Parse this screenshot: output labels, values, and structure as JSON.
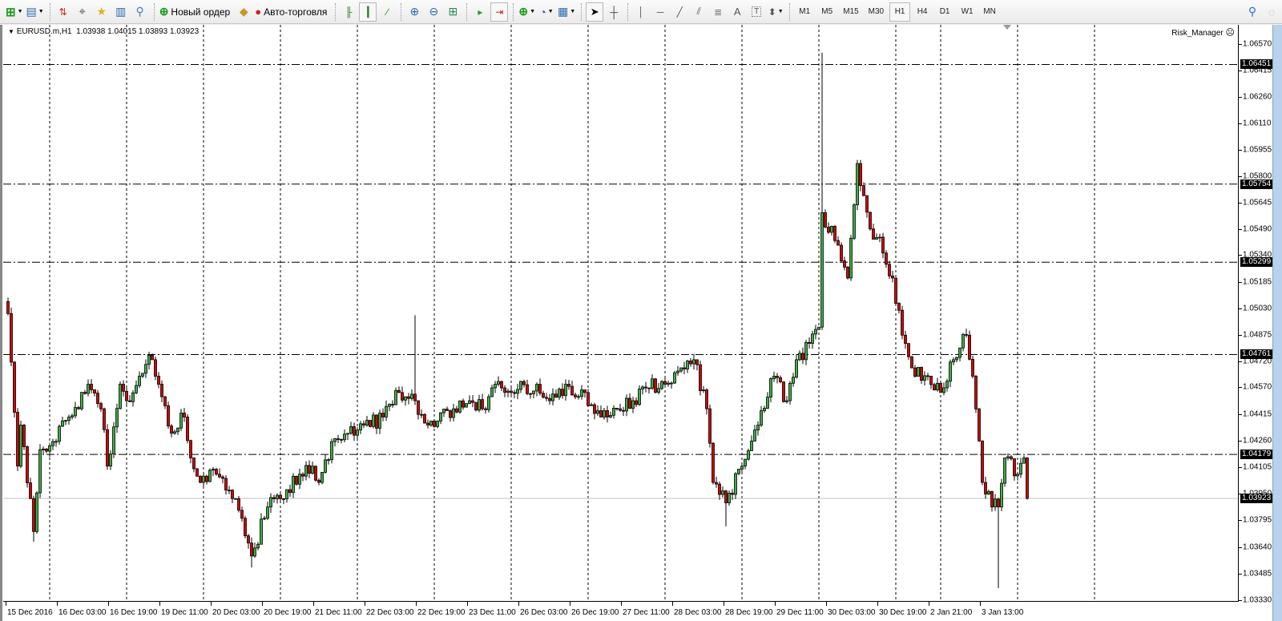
{
  "toolbar": {
    "new_order_label": "Новый ордер",
    "autotrading_label": "Авто-торговля",
    "text_tool_label": "A",
    "text_label_tool": "T",
    "periods": [
      "M1",
      "M5",
      "M15",
      "M30",
      "H1",
      "H4",
      "D1",
      "W1",
      "MN"
    ],
    "active_period": "H1"
  },
  "chart_header": {
    "symbol": "EURUSD.m,H1",
    "open": "1.03938",
    "high": "1.04015",
    "low": "1.03893",
    "close": "1.03923"
  },
  "expert": {
    "name": "Risk_Manager",
    "status_icon": "frown-icon"
  },
  "colors": {
    "bull": "#3cb043",
    "bear": "#d40000",
    "grid": "#000000",
    "current_line": "#c0c0c0"
  },
  "chart_data": {
    "type": "candlestick",
    "title": "EURUSD.m,H1",
    "bar_count": 319,
    "ylim": [
      1.0333,
      1.0657
    ],
    "price_ticks": [
      "1.06570",
      "1.06415",
      "1.06260",
      "1.06110",
      "1.05955",
      "1.05800",
      "1.05645",
      "1.05490",
      "1.05340",
      "1.05185",
      "1.05030",
      "1.04875",
      "1.04720",
      "1.04570",
      "1.04415",
      "1.04260",
      "1.04105",
      "1.03950",
      "1.03795",
      "1.03640",
      "1.03485",
      "1.03330"
    ],
    "time_labels": [
      "15 Dec 2016",
      "16 Dec 03:00",
      "16 Dec 19:00",
      "19 Dec 11:00",
      "20 Dec 03:00",
      "20 Dec 19:00",
      "21 Dec 11:00",
      "22 Dec 03:00",
      "22 Dec 19:00",
      "23 Dec 11:00",
      "26 Dec 03:00",
      "26 Dec 19:00",
      "27 Dec 11:00",
      "28 Dec 03:00",
      "28 Dec 19:00",
      "29 Dec 11:00",
      "30 Dec 03:00",
      "30 Dec 19:00",
      "2 Jan 21:00",
      "3 Jan 13:00"
    ],
    "bars_per_time_label": 16,
    "horizontal_lines": [
      "1.06451",
      "1.05754",
      "1.05299",
      "1.04761",
      "1.04179"
    ],
    "current_price": "1.03923",
    "close_path": [
      [
        0,
        1.05
      ],
      [
        3,
        1.04111
      ],
      [
        4,
        1.0435
      ],
      [
        8,
        1.0373
      ],
      [
        10,
        1.04207
      ],
      [
        14,
        1.04254
      ],
      [
        19,
        1.04397
      ],
      [
        25,
        1.04588
      ],
      [
        29,
        1.04445
      ],
      [
        31,
        1.04111
      ],
      [
        35,
        1.04588
      ],
      [
        37,
        1.04492
      ],
      [
        41,
        1.04635
      ],
      [
        45,
        1.04731
      ],
      [
        47,
        1.04588
      ],
      [
        51,
        1.04302
      ],
      [
        55,
        1.04397
      ],
      [
        57,
        1.04159
      ],
      [
        60,
        1.04016
      ],
      [
        65,
        1.04064
      ],
      [
        71,
        1.03921
      ],
      [
        76,
        1.03587
      ],
      [
        81,
        1.03873
      ],
      [
        86,
        1.03921
      ],
      [
        91,
        1.04064
      ],
      [
        95,
        1.04111
      ],
      [
        97,
        1.04016
      ],
      [
        101,
        1.04254
      ],
      [
        106,
        1.04302
      ],
      [
        111,
        1.0435
      ],
      [
        117,
        1.04397
      ],
      [
        122,
        1.0454
      ],
      [
        127,
        1.04492
      ],
      [
        131,
        1.0435
      ],
      [
        134,
        1.04373
      ],
      [
        139,
        1.04445
      ],
      [
        144,
        1.04492
      ],
      [
        148,
        1.04445
      ],
      [
        152,
        1.04588
      ],
      [
        157,
        1.0454
      ],
      [
        165,
        1.04588
      ],
      [
        169,
        1.04492
      ],
      [
        174,
        1.04588
      ],
      [
        180,
        1.0454
      ],
      [
        185,
        1.04397
      ],
      [
        190,
        1.04445
      ],
      [
        195,
        1.04492
      ],
      [
        200,
        1.04565
      ],
      [
        205,
        1.04588
      ],
      [
        213,
        1.04707
      ],
      [
        214,
        1.04731
      ],
      [
        218,
        1.04445
      ],
      [
        220,
        1.04016
      ],
      [
        224,
        1.03897
      ],
      [
        229,
        1.04111
      ],
      [
        234,
        1.0435
      ],
      [
        239,
        1.04635
      ],
      [
        243,
        1.04492
      ],
      [
        246,
        1.04731
      ],
      [
        250,
        1.04826
      ],
      [
        253,
        1.04921
      ],
      [
        254,
        1.05588
      ],
      [
        259,
        1.05398
      ],
      [
        262,
        1.05207
      ],
      [
        265,
        1.05874
      ],
      [
        269,
        1.05493
      ],
      [
        272,
        1.05445
      ],
      [
        276,
        1.05207
      ],
      [
        279,
        1.04874
      ],
      [
        282,
        1.04683
      ],
      [
        287,
        1.04635
      ],
      [
        291,
        1.0454
      ],
      [
        295,
        1.04731
      ],
      [
        299,
        1.04874
      ],
      [
        301,
        1.04635
      ],
      [
        304,
        1.04016
      ],
      [
        307,
        1.03873
      ],
      [
        309,
        1.03873
      ],
      [
        311,
        1.04159
      ],
      [
        315,
        1.04064
      ],
      [
        317,
        1.04159
      ],
      [
        318,
        1.03923
      ]
    ],
    "extremes": [
      {
        "bar": 254,
        "high": 1.0652
      },
      {
        "bar": 127,
        "high": 1.0499
      },
      {
        "bar": 309,
        "low": 1.034
      },
      {
        "bar": 8,
        "low": 1.0367
      },
      {
        "bar": 76,
        "low": 1.0352
      },
      {
        "bar": 224,
        "low": 1.0376
      }
    ]
  }
}
